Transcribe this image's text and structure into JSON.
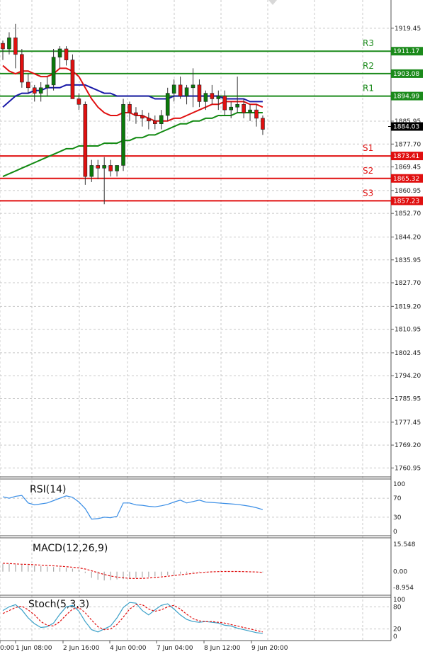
{
  "chart_data": {
    "type": "candlestick",
    "main": {
      "y_ticks": [
        "1919.45",
        "1911.17",
        "1903.08",
        "1894.99",
        "1885.95",
        "1877.70",
        "1869.45",
        "1860.95",
        "1852.70",
        "1844.20",
        "1835.95",
        "1827.70",
        "1819.20",
        "1810.95",
        "1802.45",
        "1794.20",
        "1785.95",
        "1777.45",
        "1769.20",
        "1760.95"
      ],
      "ylim": [
        1758.5,
        1924
      ],
      "current_price": "1884.03",
      "levels": [
        {
          "name": "R3",
          "value": "1911.17",
          "kind": "resistance"
        },
        {
          "name": "R2",
          "value": "1903.08",
          "kind": "resistance"
        },
        {
          "name": "R1",
          "value": "1894.99",
          "kind": "resistance"
        },
        {
          "name": "S1",
          "value": "1873.41",
          "kind": "support"
        },
        {
          "name": "S2",
          "value": "1865.32",
          "kind": "support"
        },
        {
          "name": "S3",
          "value": "1857.23",
          "kind": "support"
        }
      ],
      "candles": [
        [
          1914,
          1915,
          1908,
          1912
        ],
        [
          1912,
          1918,
          1910,
          1916
        ],
        [
          1916,
          1921,
          1905,
          1910
        ],
        [
          1910,
          1912,
          1898,
          1900
        ],
        [
          1900,
          1903,
          1896,
          1898
        ],
        [
          1898,
          1899,
          1893,
          1896
        ],
        [
          1896,
          1900,
          1893,
          1898
        ],
        [
          1898,
          1902,
          1895,
          1899
        ],
        [
          1899,
          1912,
          1897,
          1909
        ],
        [
          1909,
          1913,
          1905,
          1912
        ],
        [
          1912,
          1913,
          1906,
          1908
        ],
        [
          1908,
          1910,
          1895,
          1894
        ],
        [
          1894,
          1896,
          1890,
          1892
        ],
        [
          1892,
          1893,
          1863,
          1866
        ],
        [
          1866,
          1872,
          1864,
          1870
        ],
        [
          1870,
          1872,
          1865,
          1869
        ],
        [
          1869,
          1873,
          1856,
          1870
        ],
        [
          1870,
          1872,
          1866,
          1868
        ],
        [
          1868,
          1870,
          1866,
          1870
        ],
        [
          1870,
          1894,
          1868,
          1892
        ],
        [
          1892,
          1893,
          1886,
          1889
        ],
        [
          1889,
          1891,
          1885,
          1888
        ],
        [
          1888,
          1890,
          1884,
          1887
        ],
        [
          1887,
          1889,
          1883,
          1886
        ],
        [
          1886,
          1888,
          1883,
          1885
        ],
        [
          1885,
          1890,
          1883,
          1888
        ],
        [
          1888,
          1898,
          1886,
          1896
        ],
        [
          1896,
          1901,
          1893,
          1899
        ],
        [
          1899,
          1902,
          1894,
          1895
        ],
        [
          1895,
          1899,
          1892,
          1898
        ],
        [
          1898,
          1905,
          1891,
          1899
        ],
        [
          1899,
          1901,
          1891,
          1893
        ],
        [
          1893,
          1897,
          1890,
          1896
        ],
        [
          1896,
          1899,
          1892,
          1894
        ],
        [
          1894,
          1897,
          1890,
          1895
        ],
        [
          1895,
          1897,
          1888,
          1890
        ],
        [
          1890,
          1893,
          1887,
          1891
        ],
        [
          1891,
          1902,
          1889,
          1892
        ],
        [
          1892,
          1894,
          1887,
          1889
        ],
        [
          1889,
          1892,
          1886,
          1890
        ],
        [
          1890,
          1892,
          1884,
          1887
        ],
        [
          1887,
          1888,
          1881,
          1883
        ]
      ],
      "ma_red": [
        1906,
        1904,
        1903,
        1904,
        1904,
        1903,
        1902,
        1902,
        1903,
        1905,
        1905,
        1904,
        1902,
        1898,
        1894,
        1891,
        1889,
        1888,
        1888,
        1889,
        1889,
        1888,
        1888,
        1887,
        1886,
        1886,
        1886,
        1887,
        1887,
        1888,
        1889,
        1890,
        1891,
        1892,
        1892,
        1893,
        1893,
        1893,
        1893,
        1892,
        1892,
        1891
      ],
      "ma_blue": [
        1891,
        1893,
        1895,
        1896,
        1896,
        1897,
        1897,
        1898,
        1898,
        1898,
        1899,
        1899,
        1899,
        1899,
        1898,
        1897,
        1896,
        1896,
        1895,
        1895,
        1895,
        1895,
        1895,
        1895,
        1894,
        1894,
        1894,
        1895,
        1895,
        1895,
        1895,
        1895,
        1895,
        1895,
        1895,
        1894,
        1894,
        1894,
        1894,
        1893,
        1893,
        1893
      ],
      "ma_green": [
        1866,
        1867,
        1868,
        1869,
        1870,
        1871,
        1872,
        1873,
        1874,
        1875,
        1876,
        1876,
        1877,
        1877,
        1877,
        1877,
        1878,
        1878,
        1878,
        1879,
        1879,
        1880,
        1880,
        1881,
        1881,
        1882,
        1883,
        1884,
        1885,
        1885,
        1886,
        1886,
        1887,
        1887,
        1888,
        1888,
        1888,
        1889,
        1889,
        1889,
        1889,
        1889
      ]
    },
    "rsi": {
      "title": "RSI(14)",
      "y_ticks": [
        "100",
        "70",
        "30",
        "0"
      ],
      "ylim": [
        0,
        100
      ],
      "values": [
        73,
        70,
        74,
        76,
        60,
        56,
        58,
        60,
        65,
        70,
        75,
        72,
        62,
        48,
        26,
        27,
        30,
        29,
        32,
        60,
        60,
        56,
        55,
        53,
        52,
        54,
        57,
        62,
        66,
        60,
        63,
        66,
        62,
        61,
        60,
        59,
        58,
        57,
        55,
        53,
        50,
        46
      ]
    },
    "macd": {
      "title": "MACD(12,26,9)",
      "y_ticks": [
        "15.548",
        "0.00",
        "-8.954"
      ],
      "ylim": [
        -8.954,
        15.548
      ],
      "histogram": [
        4.5,
        4.4,
        4.1,
        3.9,
        3.6,
        3.4,
        3.1,
        2.9,
        2.6,
        2.4,
        2.1,
        1.7,
        1.2,
        -0.8,
        -3.5,
        -4.6,
        -5.0,
        -4.8,
        -4.4,
        -4.2,
        -3.9,
        -3.6,
        -3.3,
        -3.0,
        -2.7,
        -2.4,
        -2.0,
        -1.5,
        -1.2,
        -0.8,
        -0.5,
        -0.3,
        -0.2,
        -0.1,
        -0.1,
        0.0,
        -0.1,
        -0.1,
        -0.2,
        -0.2,
        -0.3,
        -0.4
      ],
      "signal": [
        4.8,
        4.6,
        4.4,
        4.2,
        4.1,
        3.9,
        3.7,
        3.5,
        3.3,
        3.1,
        2.8,
        2.5,
        2.1,
        1.5,
        0.5,
        -0.6,
        -1.6,
        -2.5,
        -3.1,
        -3.5,
        -3.8,
        -3.9,
        -3.8,
        -3.6,
        -3.3,
        -3.0,
        -2.6,
        -2.2,
        -1.8,
        -1.4,
        -1.0,
        -0.6,
        -0.3,
        -0.1,
        0.0,
        0.1,
        0.1,
        0.1,
        0.0,
        -0.1,
        -0.2,
        -0.4
      ]
    },
    "stoch": {
      "title": "Stoch(5,3,3)",
      "y_ticks": [
        "100",
        "80",
        "20",
        "0"
      ],
      "ylim": [
        0,
        100
      ],
      "k": [
        70,
        80,
        86,
        72,
        50,
        34,
        24,
        26,
        36,
        60,
        80,
        84,
        68,
        40,
        18,
        12,
        20,
        28,
        50,
        78,
        92,
        90,
        70,
        58,
        72,
        84,
        88,
        74,
        58,
        46,
        40,
        38,
        40,
        38,
        36,
        30,
        28,
        22,
        18,
        14,
        10,
        8
      ],
      "d": [
        62,
        70,
        78,
        82,
        72,
        58,
        40,
        30,
        28,
        40,
        58,
        74,
        78,
        64,
        44,
        26,
        18,
        20,
        32,
        52,
        74,
        86,
        86,
        74,
        68,
        72,
        80,
        84,
        74,
        60,
        48,
        42,
        40,
        40,
        38,
        36,
        32,
        28,
        24,
        20,
        16,
        12
      ]
    },
    "x_ticks": [
      "0:00",
      "1 Jun 08:00",
      "2 Jun 16:00",
      "4 Jun 00:00",
      "7 Jun 04:00",
      "8 Jun 12:00",
      "9 Jun 20:00"
    ],
    "colors": {
      "up": "#0a7a0a",
      "down": "#e01010",
      "ma_red": "#e01010",
      "ma_blue": "#1a1aa8",
      "ma_green": "#128a12",
      "resistance": "#1b8a1b",
      "support": "#e01010",
      "rsi": "#3a8ee6",
      "stoch_k": "#3aa0c8",
      "stoch_d": "#e01010",
      "grid": "#c8c8c8"
    }
  }
}
